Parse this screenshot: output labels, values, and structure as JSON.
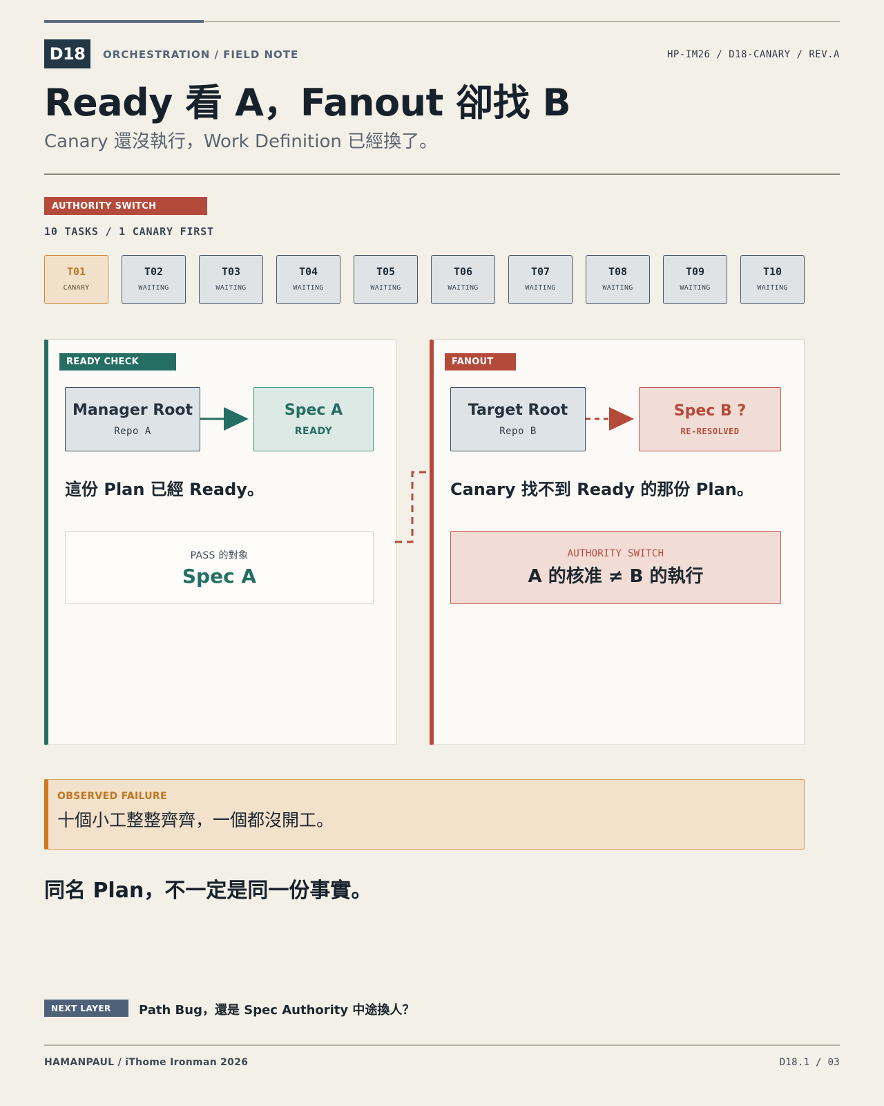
{
  "header": {
    "badge": "D18",
    "kicker": "ORCHESTRATION / FIELD NOTE",
    "doc_ref": "HP-IM26 / D18-CANARY / REV.A",
    "title": "Ready 看 A，Fanout 卻找 B",
    "subtitle": "Canary 還沒執行，Work Definition 已經換了。"
  },
  "tasks_section": {
    "tag": "AUTHORITY SWITCH",
    "caption": "10 TASKS / 1 CANARY FIRST",
    "tasks": [
      {
        "id": "T01",
        "status": "CANARY"
      },
      {
        "id": "T02",
        "status": "WAITING"
      },
      {
        "id": "T03",
        "status": "WAITING"
      },
      {
        "id": "T04",
        "status": "WAITING"
      },
      {
        "id": "T05",
        "status": "WAITING"
      },
      {
        "id": "T06",
        "status": "WAITING"
      },
      {
        "id": "T07",
        "status": "WAITING"
      },
      {
        "id": "T08",
        "status": "WAITING"
      },
      {
        "id": "T09",
        "status": "WAITING"
      },
      {
        "id": "T10",
        "status": "WAITING"
      }
    ]
  },
  "ready_panel": {
    "tag": "READY CHECK",
    "source": {
      "title": "Manager Root",
      "sub": "Repo A"
    },
    "target": {
      "title": "Spec A",
      "sub": "READY"
    },
    "statement": "這份 Plan 已經 Ready。",
    "result_label": "PASS 的對象",
    "result_value": "Spec A"
  },
  "fanout_panel": {
    "tag": "FANOUT",
    "source": {
      "title": "Target Root",
      "sub": "Repo B"
    },
    "target": {
      "title": "Spec B ?",
      "sub": "RE-RESOLVED"
    },
    "statement": "Canary 找不到 Ready 的那份 Plan。",
    "result_label": "AUTHORITY SWITCH",
    "result_value": "A 的核准 ≠ B 的執行"
  },
  "failure": {
    "label": "OBSERVED FAILURE",
    "text": "十個小工整整齊齊，一個都沒開工。"
  },
  "takeaway": "同名 Plan，不一定是同一份事實。",
  "next_layer": {
    "tag": "NEXT LAYER",
    "text": "Path Bug，還是 Spec Authority 中途換人？"
  },
  "footer": {
    "left": "HAMANPAUL / iThome Ironman 2026",
    "right": "D18.1 / 03"
  },
  "colors": {
    "ready_green": "#256e63",
    "authority_red": "#b44a3a",
    "canary_amber": "#cf7a1f",
    "ink": "#1d2730"
  }
}
